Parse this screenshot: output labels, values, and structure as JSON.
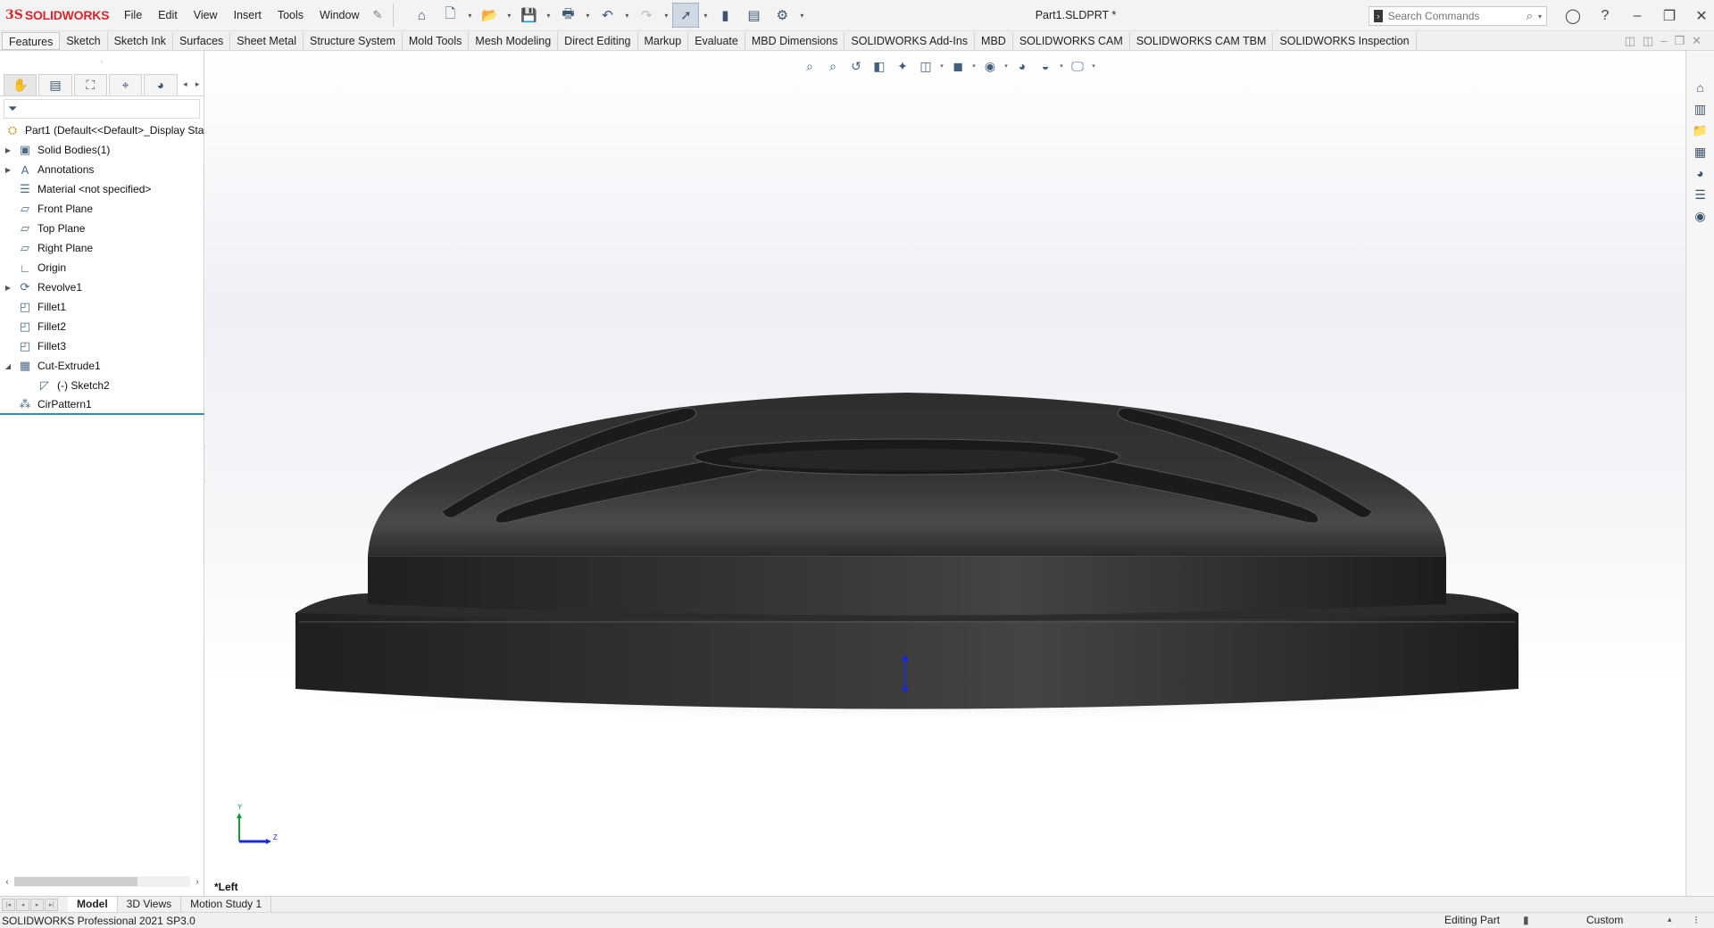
{
  "app": {
    "brand_prefix": "3S",
    "brand_name": "SOLIDWORKS",
    "document_title": "Part1.SLDPRT *"
  },
  "menu": [
    "File",
    "Edit",
    "View",
    "Insert",
    "Tools",
    "Window"
  ],
  "search": {
    "placeholder": "Search Commands"
  },
  "command_tabs": [
    "Features",
    "Sketch",
    "Sketch Ink",
    "Surfaces",
    "Sheet Metal",
    "Structure System",
    "Mold Tools",
    "Mesh Modeling",
    "Direct Editing",
    "Markup",
    "Evaluate",
    "MBD Dimensions",
    "SOLIDWORKS Add-Ins",
    "MBD",
    "SOLIDWORKS CAM",
    "SOLIDWORKS CAM TBM",
    "SOLIDWORKS Inspection"
  ],
  "tree": {
    "root": "Part1  (Default<<Default>_Display Sta",
    "items": [
      {
        "label": "Solid Bodies(1)",
        "icon": "solid-bodies-icon",
        "expandable": true
      },
      {
        "label": "Annotations",
        "icon": "annotations-icon",
        "expandable": true
      },
      {
        "label": "Material <not specified>",
        "icon": "material-icon",
        "expandable": false
      },
      {
        "label": "Front Plane",
        "icon": "plane-icon",
        "expandable": false
      },
      {
        "label": "Top Plane",
        "icon": "plane-icon",
        "expandable": false
      },
      {
        "label": "Right Plane",
        "icon": "plane-icon",
        "expandable": false
      },
      {
        "label": "Origin",
        "icon": "origin-icon",
        "expandable": false
      },
      {
        "label": "Revolve1",
        "icon": "revolve-icon",
        "expandable": true
      },
      {
        "label": "Fillet1",
        "icon": "fillet-icon",
        "expandable": false
      },
      {
        "label": "Fillet2",
        "icon": "fillet-icon",
        "expandable": false
      },
      {
        "label": "Fillet3",
        "icon": "fillet-icon",
        "expandable": false
      },
      {
        "label": "Cut-Extrude1",
        "icon": "cut-extrude-icon",
        "expandable": true,
        "expanded": true
      },
      {
        "label": "(-) Sketch2",
        "icon": "sketch-icon",
        "expandable": false,
        "child": true
      },
      {
        "label": "CirPattern1",
        "icon": "circular-pattern-icon",
        "expandable": false
      }
    ]
  },
  "viewport": {
    "view_name": "*Left",
    "triad": {
      "y_label": "Y",
      "z_label": "Z"
    }
  },
  "bottom_tabs": [
    "Model",
    "3D Views",
    "Motion Study 1"
  ],
  "status": {
    "product": "SOLIDWORKS Professional 2021 SP3.0",
    "mode": "Editing Part",
    "units": "Custom"
  },
  "colors": {
    "brand_red": "#d6262b",
    "model_dark": "#2a2a2a",
    "selection_blue": "#2f8ac6"
  }
}
